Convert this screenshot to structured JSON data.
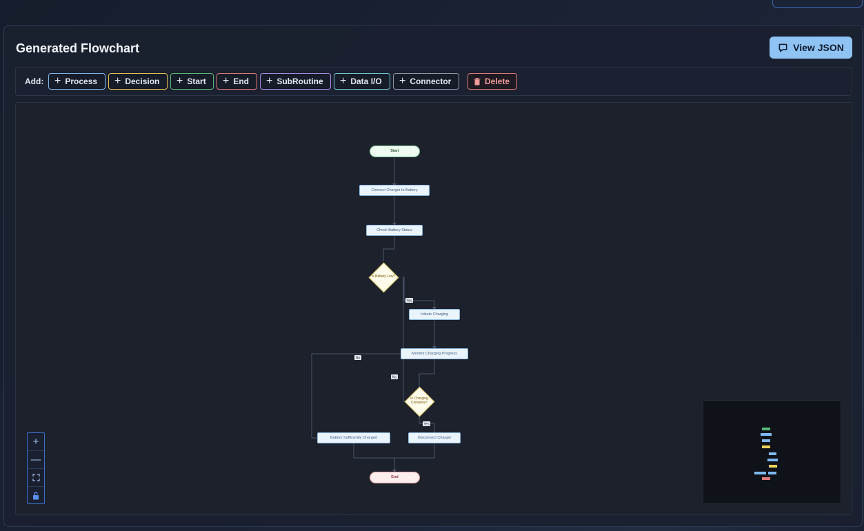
{
  "title": "Generated Flowchart",
  "view_json_label": "View JSON",
  "toolbar": {
    "add_label": "Add:",
    "buttons": [
      {
        "label": "Process",
        "icon": "plus-icon",
        "color": "#7db8ef"
      },
      {
        "label": "Decision",
        "icon": "plus-icon",
        "color": "#e6c24f"
      },
      {
        "label": "Start",
        "icon": "plus-icon",
        "color": "#58b975"
      },
      {
        "label": "End",
        "icon": "plus-icon",
        "color": "#e07a7a"
      },
      {
        "label": "SubRoutine",
        "icon": "plus-icon",
        "color": "#a98be8"
      },
      {
        "label": "Data I/O",
        "icon": "plus-icon",
        "color": "#6ecbd6"
      },
      {
        "label": "Connector",
        "icon": "plus-icon",
        "color": "#8e99aa"
      }
    ],
    "delete": {
      "label": "Delete",
      "icon": "trash-icon",
      "color": "#e07a7a"
    }
  },
  "flowchart": {
    "nodes": {
      "start": "Start",
      "connect": "Connect Charger to Battery",
      "check": "Check Battery Status",
      "low": "Is Battery Low?",
      "initiate": "Initiate Charging",
      "monitor": "Monitor Charging Progress",
      "complete": "Is Charging Complete?",
      "sufficient": "Battery Sufficiently Charged",
      "disconnect": "Disconnect Charger",
      "end": "End"
    },
    "edges": {
      "low_yes": "Yes",
      "low_no": "No",
      "complete_no": "No",
      "complete_yes": "Yes"
    }
  },
  "controls": [
    "zoom-in",
    "zoom-out",
    "fit-view",
    "lock"
  ],
  "colors": {
    "process": "#8ab7e2",
    "decision": "#e0c35a",
    "start": "#7cc593",
    "end": "#e29a9a",
    "edge": "#4a5568",
    "accent": "#8fc3f4"
  }
}
